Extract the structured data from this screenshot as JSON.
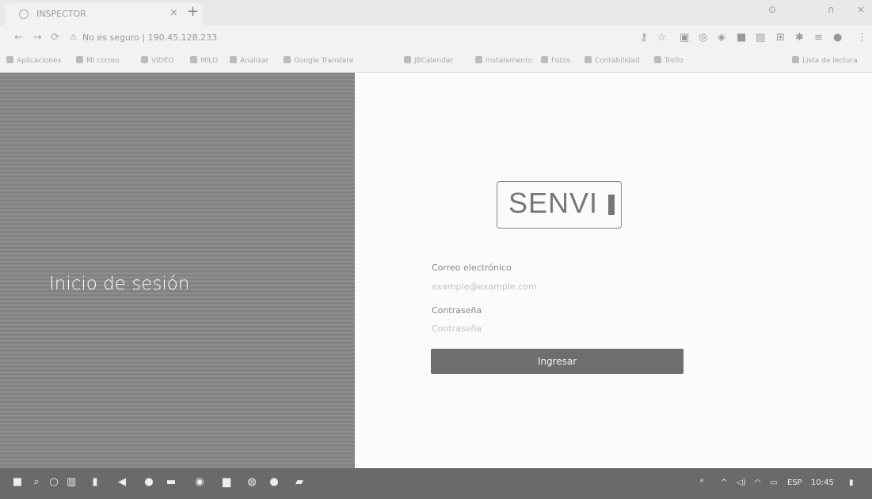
{
  "browser": {
    "tab_title": "INSPECTOR",
    "tab_close": "×",
    "new_tab": "+",
    "window_controls": {
      "minimize": "⊙",
      "maximize": "∩",
      "close": "×"
    },
    "nav": {
      "back": "←",
      "forward": "→",
      "reload": "⟳"
    },
    "address": "No es seguro | 190.45.128.233",
    "address_icon": "warning-icon",
    "bookmarks": [
      "Aplicaciones",
      "Mi correo",
      "VIDEO",
      "MILO",
      "Analizar",
      "Google Translate",
      "JBCalendar",
      "Instalamento",
      "Fotos",
      "Contabilidad",
      "Trello",
      "Lista de lectura"
    ]
  },
  "page": {
    "left_title": "Inicio de sesión",
    "logo_text": "SENVI",
    "email_label": "Correo electrónico",
    "email_placeholder": "example@example.com",
    "password_label": "Contraseña",
    "password_placeholder": "Contraseña",
    "submit_label": "Ingresar"
  },
  "taskbar": {
    "language": "ESP",
    "time": "10:45"
  },
  "colors": {
    "left_panel": "#8a8a8a",
    "button": "#6e6e6e",
    "taskbar": "#6a6a6a"
  }
}
